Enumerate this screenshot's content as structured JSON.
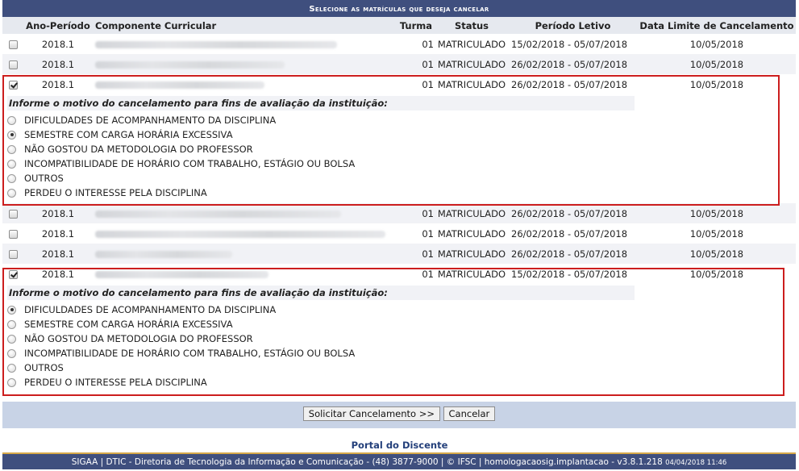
{
  "title": "Selecione as matrículas que deseja cancelar",
  "columns": {
    "ano": "Ano-Período",
    "componente": "Componente Curricular",
    "turma": "Turma",
    "status": "Status",
    "periodo": "Período Letivo",
    "data_limite": "Data Limite de Cancelamento"
  },
  "rows": [
    {
      "ano": "2018.1",
      "turma": "01",
      "status": "MATRICULADO",
      "periodo": "15/02/2018 - 05/07/2018",
      "data_limite": "10/05/2018",
      "checked": false
    },
    {
      "ano": "2018.1",
      "turma": "01",
      "status": "MATRICULADO",
      "periodo": "26/02/2018 - 05/07/2018",
      "data_limite": "10/05/2018",
      "checked": false
    },
    {
      "ano": "2018.1",
      "turma": "01",
      "status": "MATRICULADO",
      "periodo": "26/02/2018 - 05/07/2018",
      "data_limite": "10/05/2018",
      "checked": true
    },
    {
      "ano": "2018.1",
      "turma": "01",
      "status": "MATRICULADO",
      "periodo": "26/02/2018 - 05/07/2018",
      "data_limite": "10/05/2018",
      "checked": false
    },
    {
      "ano": "2018.1",
      "turma": "01",
      "status": "MATRICULADO",
      "periodo": "26/02/2018 - 05/07/2018",
      "data_limite": "10/05/2018",
      "checked": false
    },
    {
      "ano": "2018.1",
      "turma": "01",
      "status": "MATRICULADO",
      "periodo": "26/02/2018 - 05/07/2018",
      "data_limite": "10/05/2018",
      "checked": false
    },
    {
      "ano": "2018.1",
      "turma": "01",
      "status": "MATRICULADO",
      "periodo": "15/02/2018 - 05/07/2018",
      "data_limite": "10/05/2018",
      "checked": true
    }
  ],
  "motivo": {
    "title": "Informe o motivo do cancelamento para fins de avaliação da instituição:",
    "options": [
      "DIFICULDADES DE ACOMPANHAMENTO DA DISCIPLINA",
      "SEMESTRE COM CARGA HORÁRIA EXCESSIVA",
      "NÃO GOSTOU DA METODOLOGIA DO PROFESSOR",
      "INCOMPATIBILIDADE DE HORÁRIO COM TRABALHO, ESTÁGIO OU BOLSA",
      "OUTROS",
      "PERDEU O INTERESSE PELA DISCIPLINA"
    ],
    "selected_first": 1,
    "selected_second": 0
  },
  "buttons": {
    "solicitar": "Solicitar Cancelamento >>",
    "cancelar": "Cancelar"
  },
  "portal_link": "Portal do Discente",
  "footer": {
    "text": "SIGAA | DTIC - Diretoria de Tecnologia da Informação e Comunicação - (48) 3877-9000 | © IFSC | homologacaosig.implantacao - v3.8.1.218",
    "timestamp": "04/04/2018 11:46"
  },
  "colors": {
    "header_bar": "#3f4f7e",
    "highlight_border": "#cc1e1e",
    "action_bar": "#c8d3e6",
    "footer_accent": "#d6a94a"
  }
}
